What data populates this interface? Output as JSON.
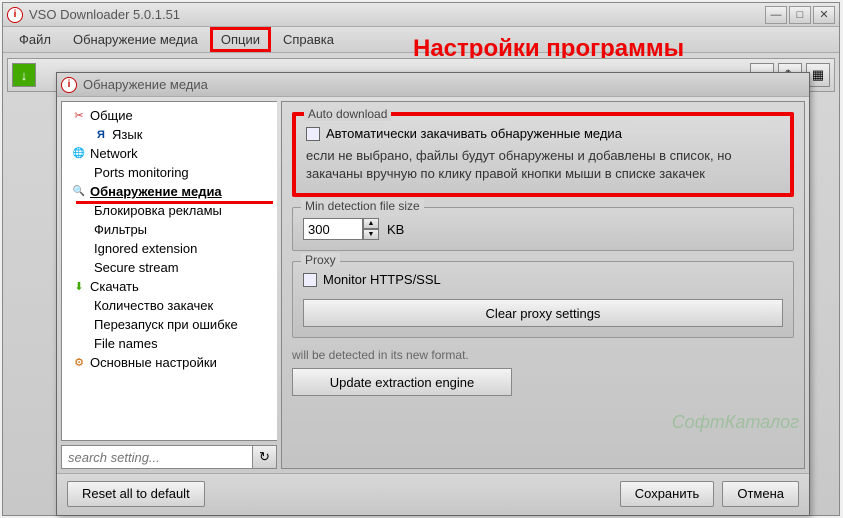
{
  "main_window": {
    "title": "VSO Downloader 5.0.1.51",
    "menu": [
      "Файл",
      "Обнаружение медиа",
      "Опции",
      "Справка"
    ],
    "highlighted_menu_index": 2
  },
  "annotation": "Настройки программы",
  "dialog": {
    "title": "Обнаружение медиа",
    "tree": [
      {
        "label": "Общие",
        "icon": "ic-tool",
        "level": 0
      },
      {
        "label": "Язык",
        "icon": "ic-lang",
        "level": 1
      },
      {
        "label": "Network",
        "icon": "ic-net",
        "level": 0
      },
      {
        "label": "Ports monitoring",
        "icon": "",
        "level": 1
      },
      {
        "label": "Обнаружение медиа",
        "icon": "ic-search",
        "level": 0,
        "selected": true
      },
      {
        "label": "Блокировка рекламы",
        "icon": "",
        "level": 1
      },
      {
        "label": "Фильтры",
        "icon": "",
        "level": 1
      },
      {
        "label": "Ignored extension",
        "icon": "",
        "level": 1
      },
      {
        "label": "Secure stream",
        "icon": "",
        "level": 1
      },
      {
        "label": "Скачать",
        "icon": "ic-down",
        "level": 0
      },
      {
        "label": "Количество закачек",
        "icon": "",
        "level": 1
      },
      {
        "label": "Перезапуск при ошибке",
        "icon": "",
        "level": 1
      },
      {
        "label": "File names",
        "icon": "",
        "level": 1
      },
      {
        "label": "Основные настройки",
        "icon": "ic-gear",
        "level": 0
      }
    ],
    "search_placeholder": "search setting...",
    "reset_button": "Reset all to default",
    "save_button": "Сохранить",
    "cancel_button": "Отмена"
  },
  "content": {
    "auto_download": {
      "legend": "Auto download",
      "checkbox_label": "Автоматически закачивать обнаруженные медиа",
      "description": "если не выбрано, файлы будут обнаружены и добавлены в список, но закачаны вручную по клику правой кнопки мыши в списке закачек"
    },
    "min_size": {
      "legend": "Min detection file size",
      "value": "300",
      "unit": "KB"
    },
    "proxy": {
      "legend": "Proxy",
      "checkbox_label": "Monitor HTTPS/SSL",
      "clear_button": "Clear proxy settings"
    },
    "truncated": "will be detected in its new format.",
    "update_button": "Update extraction engine"
  },
  "watermark": "СофтКаталог"
}
